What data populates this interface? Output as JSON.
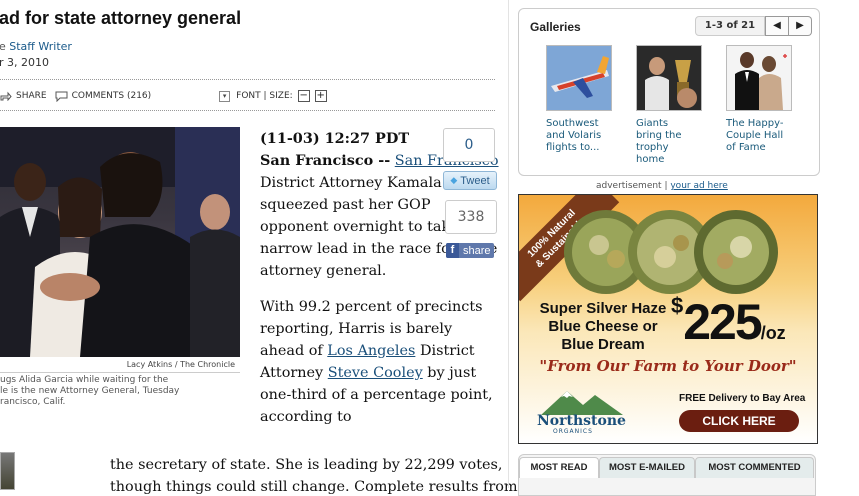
{
  "article": {
    "headline": "ad for state attorney general",
    "byline_prefix": "e ",
    "byline_author": "Staff Writer",
    "date": "r 3, 2010",
    "toolbar": {
      "share": "SHARE",
      "comments": "COMMENTS (216)",
      "font_size": "FONT | SIZE:",
      "decrease": "−",
      "increase": "+"
    },
    "photo_credit": "Lacy Atkins / The Chronicle",
    "caption": "ugs Alida Garcia while waiting for the\nle is the new Attorney General, Tuesday\nrancisco, Calif.",
    "body": {
      "time": "(11-03) 12:27 PDT",
      "city": "San Francisco --",
      "link_sf": "San Francisco",
      "p1_rest": " District Attorney Kamala Harris squeezed past her GOP opponent overnight to take a narrow lead in the race for state attorney general.",
      "p2_a": "With 99.2 percent of precincts reporting, Harris is barely ahead of ",
      "link_la": "Los Angeles",
      "p2_b": " District Attorney ",
      "link_cooley": "Steve Cooley",
      "p2_c": " by just one-third of a percentage point, according to",
      "wrap1": "the secretary of state. She is leading by 22,299 votes,",
      "wrap2": "though things could still change. Complete results from"
    }
  },
  "social": {
    "tweet_count": "0",
    "tweet_label": "Tweet",
    "share_count": "338",
    "share_label": "share",
    "facebook_glyph": "f"
  },
  "galleries": {
    "title": "Galleries",
    "counter": "1-3 of 21",
    "prev": "◀",
    "next": "▶",
    "items": [
      {
        "label": "Southwest\nand Volaris\nflights to..."
      },
      {
        "label": "Giants\nbring the\ntrophy\nhome"
      },
      {
        "label": "The Happy-\nCouple Hall\nof Fame"
      }
    ]
  },
  "ad": {
    "label_prefix": "advertisement |",
    "label_link": "your ad here",
    "ribbon": "100% Natural\n& Sustainable",
    "product": "Super Silver Haze\nBlue Cheese or\nBlue Dream",
    "price_currency": "$",
    "price": "225",
    "price_unit": "/oz",
    "slogan": "\"From Our Farm to Your Door\"",
    "brand": "Northstone",
    "brand_sub": "ORGANICS",
    "delivery": "FREE Delivery to Bay Area",
    "cta": "CLICK HERE"
  },
  "most_tabs": [
    "MOST READ",
    "MOST E-MAILED",
    "MOST COMMENTED"
  ]
}
